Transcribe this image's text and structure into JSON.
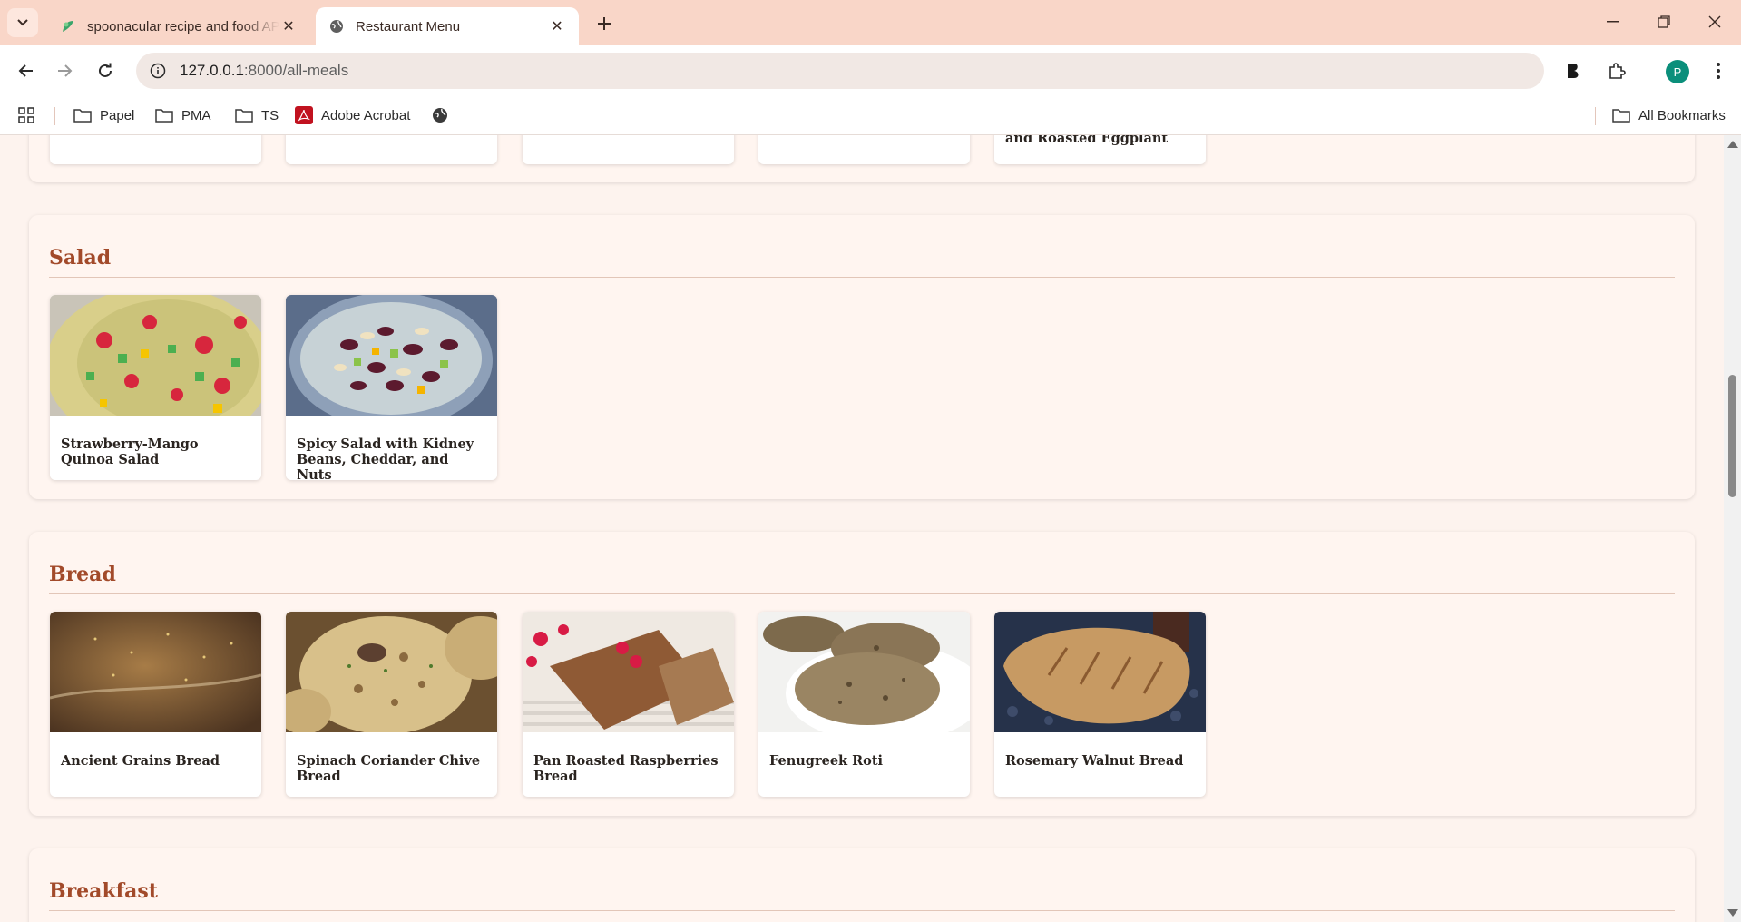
{
  "browser": {
    "tabs": [
      {
        "title": "spoonacular recipe and food API",
        "active": false,
        "favicon": "spoonacular-logo-icon"
      },
      {
        "title": "Restaurant Menu",
        "active": true,
        "favicon": "globe-icon"
      }
    ],
    "url_host": "127.0.0.1",
    "url_path": ":8000/all-meals",
    "profile_initial": "P",
    "bookmarks": [
      {
        "label": "Papel",
        "icon": "folder-icon"
      },
      {
        "label": "PMA",
        "icon": "folder-icon"
      },
      {
        "label": "TS",
        "icon": "folder-icon"
      },
      {
        "label": "Adobe Acrobat",
        "icon": "adobe-acrobat-icon"
      },
      {
        "label": "",
        "icon": "globe-icon"
      }
    ],
    "all_bookmarks_label": "All Bookmarks"
  },
  "menu": {
    "top_partial": {
      "cards": [
        {
          "name": ""
        },
        {
          "name": ""
        },
        {
          "name": ""
        },
        {
          "name": ""
        },
        {
          "name": "and Roasted Eggplant"
        }
      ]
    },
    "sections": [
      {
        "title": "Salad",
        "meals": [
          {
            "name": "Strawberry-Mango Quinoa Salad",
            "image": "strawberry-mango-quinoa-salad-photo"
          },
          {
            "name": "Spicy Salad with Kidney Beans, Cheddar, and Nuts",
            "image": "spicy-kidney-bean-salad-photo"
          }
        ]
      },
      {
        "title": "Bread",
        "meals": [
          {
            "name": "Ancient Grains Bread",
            "image": "ancient-grains-bread-photo"
          },
          {
            "name": "Spinach Coriander Chive Bread",
            "image": "spinach-coriander-chive-bread-photo"
          },
          {
            "name": "Pan Roasted Raspberries Bread",
            "image": "pan-roasted-raspberries-bread-photo"
          },
          {
            "name": "Fenugreek Roti",
            "image": "fenugreek-roti-photo"
          },
          {
            "name": "Rosemary Walnut Bread",
            "image": "rosemary-walnut-bread-photo"
          }
        ]
      },
      {
        "title": "Breakfast",
        "meals": []
      }
    ]
  },
  "colors": {
    "accent_heading": "#a24a2a",
    "tab_strip": "#f9d6c8",
    "page_background": "#fdf3ee"
  }
}
